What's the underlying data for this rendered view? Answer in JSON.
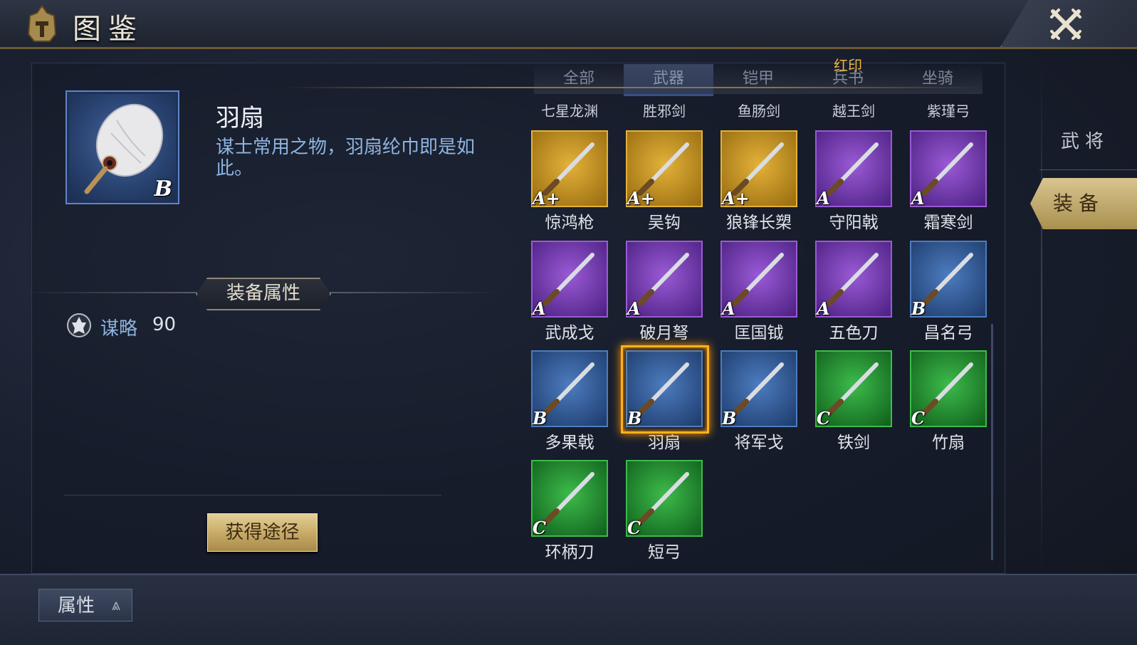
{
  "header": {
    "title": "图鉴",
    "close_icon": "close-crossed-swords-icon"
  },
  "detail": {
    "name": "羽扇",
    "description": "谋士常用之物，羽扇纶巾即是如此。",
    "grade": "B",
    "section_label": "装备属性",
    "stat": {
      "name": "谋略",
      "value": "90",
      "icon": "strategy-icon"
    },
    "obtain_button": "获得途径"
  },
  "tabs": [
    {
      "label": "全部"
    },
    {
      "label": "武器",
      "active": true
    },
    {
      "label": "铠甲"
    },
    {
      "label": "兵书",
      "badge": "红印"
    },
    {
      "label": "坐骑"
    }
  ],
  "partial_row": [
    "七星龙渊",
    "胜邪剑",
    "鱼肠剑",
    "越王剑",
    "紫瑾弓"
  ],
  "items": [
    {
      "name": "惊鸿枪",
      "grade": "A+",
      "quality": "gold"
    },
    {
      "name": "吴钩",
      "grade": "A+",
      "quality": "gold"
    },
    {
      "name": "狼锋长槊",
      "grade": "A+",
      "quality": "gold"
    },
    {
      "name": "守阳戟",
      "grade": "A",
      "quality": "purple"
    },
    {
      "name": "霜寒剑",
      "grade": "A",
      "quality": "purple"
    },
    {
      "name": "武成戈",
      "grade": "A",
      "quality": "purple"
    },
    {
      "name": "破月弩",
      "grade": "A",
      "quality": "purple"
    },
    {
      "name": "匡国钺",
      "grade": "A",
      "quality": "purple"
    },
    {
      "name": "五色刀",
      "grade": "A",
      "quality": "purple"
    },
    {
      "name": "昌名弓",
      "grade": "B",
      "quality": "blue"
    },
    {
      "name": "多果戟",
      "grade": "B",
      "quality": "blue"
    },
    {
      "name": "羽扇",
      "grade": "B",
      "quality": "blue",
      "selected": true
    },
    {
      "name": "将军戈",
      "grade": "B",
      "quality": "blue"
    },
    {
      "name": "铁剑",
      "grade": "C",
      "quality": "green"
    },
    {
      "name": "竹扇",
      "grade": "C",
      "quality": "green"
    },
    {
      "name": "环柄刀",
      "grade": "C",
      "quality": "green"
    },
    {
      "name": "短弓",
      "grade": "C",
      "quality": "green"
    }
  ],
  "side_tabs": [
    {
      "label": "武将"
    },
    {
      "label": "装备",
      "active": true
    }
  ],
  "footer": {
    "attr_button": "属性"
  },
  "colors": {
    "gold": "#c9961c",
    "purple": "#7a3fb4",
    "blue": "#2d5c9c",
    "green": "#1f8a2e",
    "selected": "#ffb11a"
  }
}
